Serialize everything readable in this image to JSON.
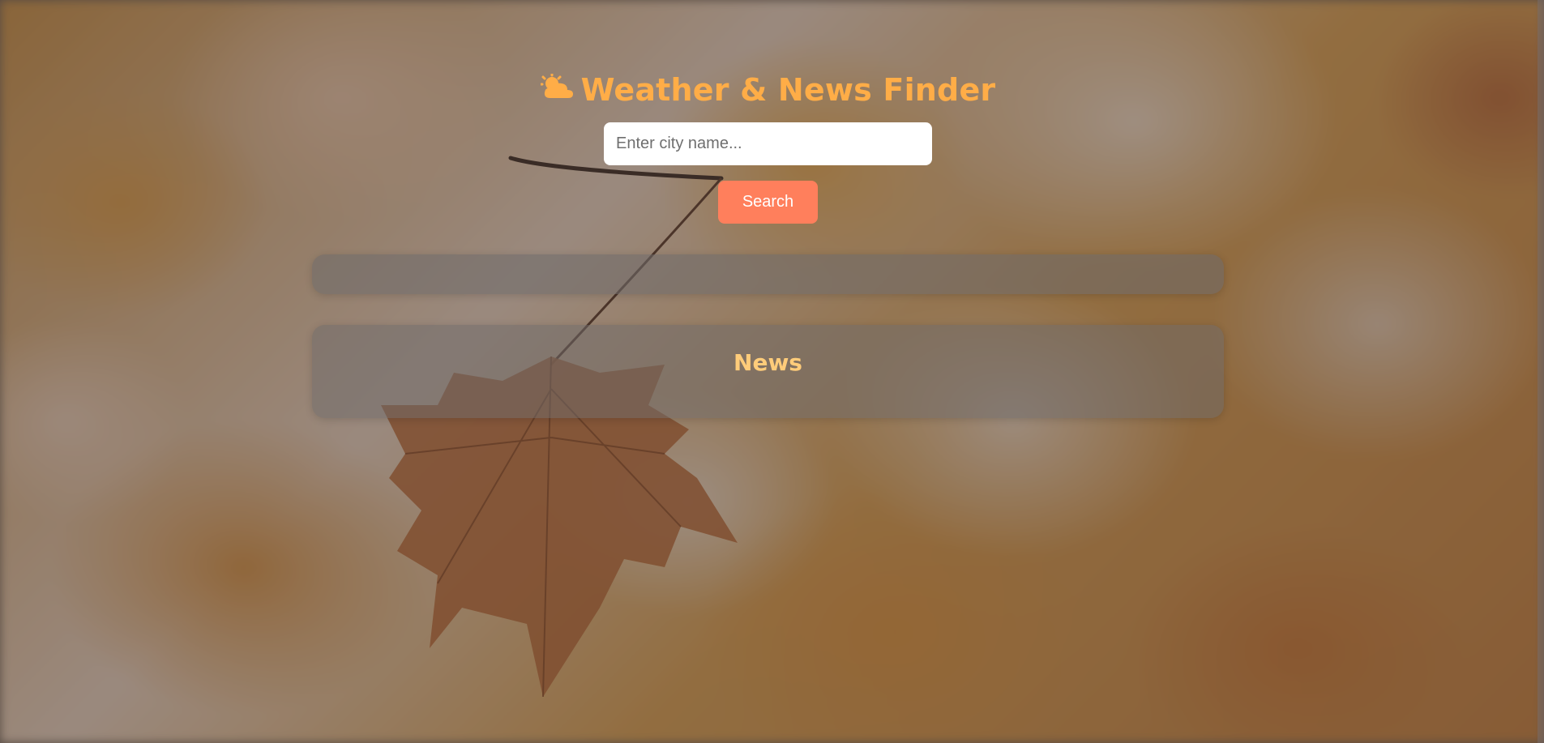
{
  "header": {
    "icon": "sun-behind-cloud-icon",
    "title": "Weather & News Finder"
  },
  "search": {
    "placeholder": "Enter city name...",
    "value": "",
    "button_label": "Search"
  },
  "weather": {
    "content": ""
  },
  "news": {
    "heading": "News"
  },
  "colors": {
    "title": "#ffad47",
    "button": "#ff7f5c",
    "news_heading": "#ffcc7a"
  }
}
